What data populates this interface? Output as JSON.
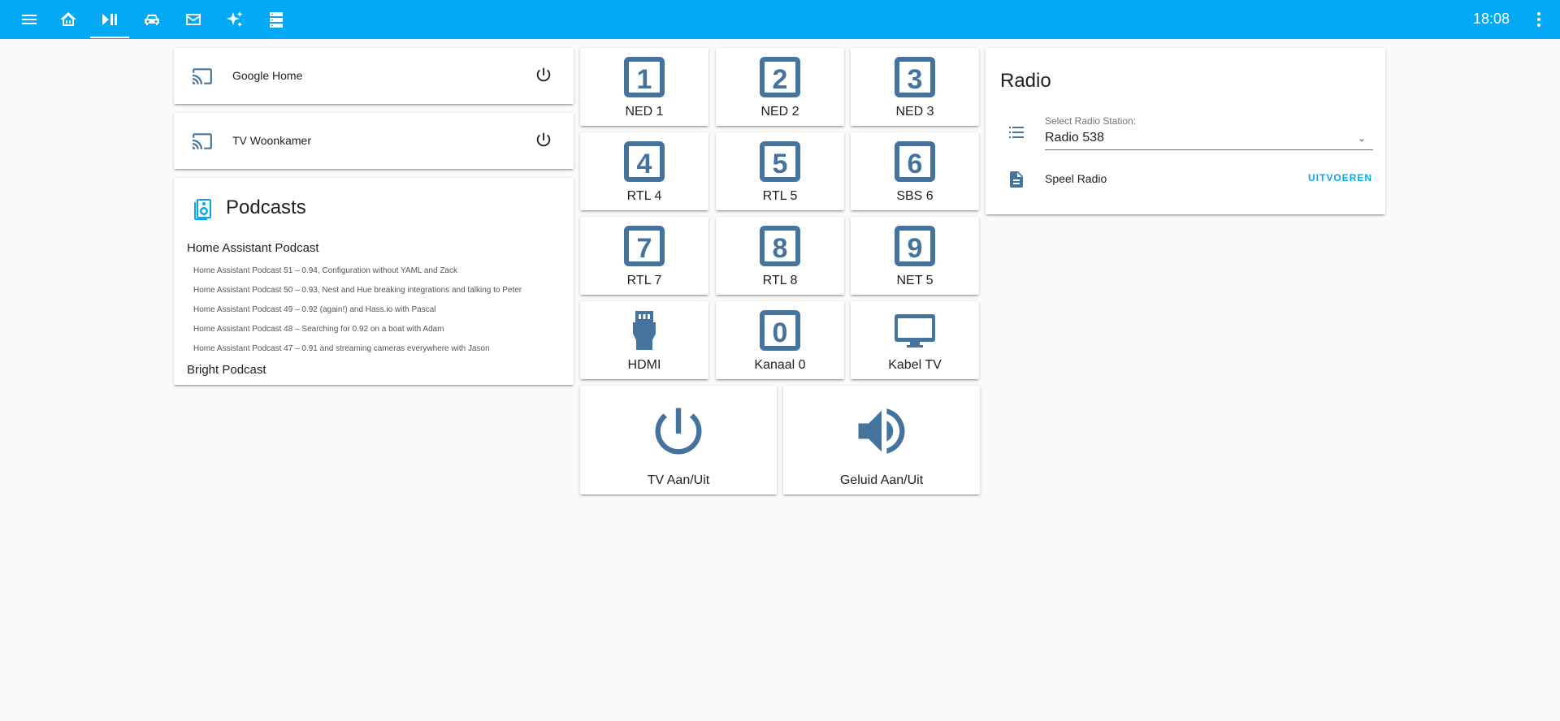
{
  "toolbar": {
    "clock": "18:08",
    "icons": [
      "menu-icon",
      "home-automation-icon",
      "play-pause-icon",
      "car-icon",
      "mail-icon",
      "sparkles-icon",
      "server-icon",
      "more-vert-icon"
    ],
    "active_tab": "play-pause-icon",
    "accent_color": "#03a9f4"
  },
  "media_players": [
    {
      "name": "Google Home",
      "icon": "cast-icon",
      "action_icon": "power-icon"
    },
    {
      "name": "TV Woonkamer",
      "icon": "cast-icon",
      "action_icon": "power-icon"
    }
  ],
  "podcasts": {
    "title": "Podcasts",
    "groups": [
      {
        "name": "Home Assistant Podcast",
        "episodes": [
          "Home Assistant Podcast 51 – 0.94, Configuration without YAML and Zack",
          "Home Assistant Podcast 50 – 0.93, Nest and Hue breaking integrations and talking to Peter",
          "Home Assistant Podcast 49 – 0.92 (again!) and Hass.io with Pascal",
          "Home Assistant Podcast 48 – Searching for 0.92 on a boat with Adam",
          "Home Assistant Podcast 47 – 0.91 and streaming cameras everywhere with Jason"
        ]
      },
      {
        "name": "Bright Podcast",
        "episodes": []
      }
    ]
  },
  "channels": [
    {
      "label": "NED 1",
      "icon": "numeric-1-box-icon",
      "digit": "1"
    },
    {
      "label": "NED 2",
      "icon": "numeric-2-box-icon",
      "digit": "2"
    },
    {
      "label": "NED 3",
      "icon": "numeric-3-box-icon",
      "digit": "3"
    },
    {
      "label": "RTL 4",
      "icon": "numeric-4-box-icon",
      "digit": "4"
    },
    {
      "label": "RTL 5",
      "icon": "numeric-5-box-icon",
      "digit": "5"
    },
    {
      "label": "SBS 6",
      "icon": "numeric-6-box-icon",
      "digit": "6"
    },
    {
      "label": "RTL 7",
      "icon": "numeric-7-box-icon",
      "digit": "7"
    },
    {
      "label": "RTL 8",
      "icon": "numeric-8-box-icon",
      "digit": "8"
    },
    {
      "label": "NET 5",
      "icon": "numeric-9-box-icon",
      "digit": "9"
    },
    {
      "label": "HDMI",
      "icon": "hdmi-port-icon"
    },
    {
      "label": "Kanaal 0",
      "icon": "numeric-0-box-icon",
      "digit": "0"
    },
    {
      "label": "Kabel TV",
      "icon": "television-icon"
    }
  ],
  "controls": [
    {
      "label": "TV Aan/Uit",
      "icon": "power-icon"
    },
    {
      "label": "Geluid Aan/Uit",
      "icon": "volume-icon"
    }
  ],
  "radio": {
    "title": "Radio",
    "select_label": "Select Radio Station:",
    "selected": "Radio 538",
    "script_name": "Speel Radio",
    "run_label": "UITVOEREN"
  },
  "icon_color": "#44739e"
}
